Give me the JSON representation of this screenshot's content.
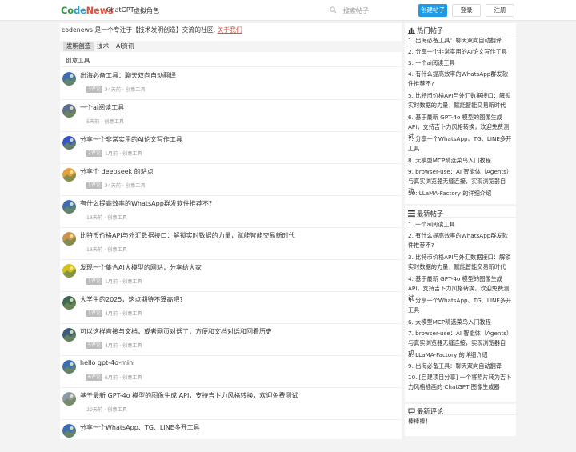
{
  "header": {
    "logo_1": "Co",
    "logo_2": "de",
    "logo_3": "News",
    "nav": [
      "ChatGPT",
      "虚拟角色"
    ],
    "search_placeholder": "搜索帖子",
    "create_button": "创建帖子",
    "login_button": "登录",
    "register_button": "注册"
  },
  "notice": {
    "text": "codenews 是一个专注于【技术发明创造】交流的社区.",
    "link": "关于我们"
  },
  "tabs": [
    "发明创造",
    "技术",
    "AI资讯"
  ],
  "subtab": "创意工具",
  "posts": [
    {
      "title": "出海必备工具：聊天双向自动翻译",
      "badge": "3评论",
      "time": "24天前",
      "category": "创意工具",
      "avatar_color": "#3b6fb2"
    },
    {
      "title": "一个ai阅读工具",
      "badge": "",
      "time": "5天前",
      "category": "创意工具",
      "avatar_color": "#5a6e8e"
    },
    {
      "title": "分享一个非常实用的AI论文写作工具",
      "badge": "2评论",
      "time": "1月前",
      "category": "创意工具",
      "avatar_color": "#3556c9"
    },
    {
      "title": "分享个 deepseek 的站点",
      "badge": "1评论",
      "time": "24天前",
      "category": "创意工具",
      "avatar_color": "#e3a23a"
    },
    {
      "title": "有什么提高效率的WhatsApp群发软件推荐不?",
      "badge": "",
      "time": "13天前",
      "category": "创意工具",
      "avatar_color": "#3b6fb2"
    },
    {
      "title": "比特币价格API与外汇数据接口：解锁实时数据的力量，赋能智能交易新时代",
      "badge": "",
      "time": "13天前",
      "category": "创意工具",
      "avatar_color": "#c9954a"
    },
    {
      "title": "发现一个集合AI大模型的网站，分享给大家",
      "badge": "1评论",
      "time": "1月前",
      "category": "创意工具",
      "avatar_color": "#d4c21a"
    },
    {
      "title": "大学生的2025，这点期待不算高吧?",
      "badge": "1评论",
      "time": "4月前",
      "category": "创意工具",
      "avatar_color": "#3d6a55"
    },
    {
      "title": "可以这样直接与文档，或者网页对话了，方便和文档对话和回看历史",
      "badge": "5评论",
      "time": "4月前",
      "category": "创意工具",
      "avatar_color": "#3b5c7a"
    },
    {
      "title": "hello gpt-4o-mini",
      "badge": "6评论",
      "time": "6月前",
      "category": "创意工具",
      "avatar_color": "#3b6fb2"
    },
    {
      "title": "基于最新 GPT-4o 模型的图像生成 API，支持吉卜力风格转换，欢迎免费测试",
      "badge": "",
      "time": "20天前",
      "category": "创意工具",
      "avatar_color": "#8a9aa8"
    },
    {
      "title": "分享一个WhatsApp、TG、LINE多开工具",
      "badge": "",
      "time": "",
      "category": "",
      "avatar_color": "#3b6fb2"
    }
  ],
  "hot": {
    "title": "热门帖子",
    "icon": "chart-icon",
    "items": [
      "1. 出海必备工具：聊天双向自动翻译",
      "2. 分享一个非常实用的AI论文写作工具",
      "3. 一个ai阅读工具",
      "4. 有什么提高效率的WhatsApp群发软件推荐不?",
      "5. 比特币价格API与外汇数据接口：解锁实时数据的力量，赋能智能交易新时代",
      "6. 基于最新 GPT-4o 模型的图像生成 API，支持吉卜力风格转换，欢迎免费测试",
      "7. 分享一个WhatsApp、TG、LINE多开工具",
      "8. 大模型MCP精选菜鸟入门教程",
      "9. browser-use：AI 智能体（Agents）与真实浏览器无缝连接，实现浏览器自动...",
      "10. LLaMA-Factory 的详细介绍"
    ]
  },
  "latest": {
    "title": "最新帖子",
    "icon": "list-icon",
    "items": [
      "1. 一个ai阅读工具",
      "2. 有什么提高效率的WhatsApp群发软件推荐不?",
      "3. 比特币价格API与外汇数据接口：解锁实时数据的力量，赋能智能交易新时代",
      "4. 基于最新 GPT-4o 模型的图像生成 API，支持吉卜力风格转换，欢迎免费测试",
      "5. 分享一个WhatsApp、TG、LINE多开工具",
      "6. 大模型MCP精选菜鸟入门教程",
      "7. browser-use：AI 智能体（Agents）与真实浏览器无缝连接，实现浏览器自动...",
      "8. LLaMA-Factory 的详细介绍",
      "9. 出海必备工具：聊天双向自动翻译",
      "10. [自建项目分享] 一个将照片转为吉卜力风格插画的 ChatGPT 图像生成器"
    ]
  },
  "comments": {
    "title": "最新评论",
    "icon": "comment-icon",
    "items": [
      "棒棒棒！"
    ]
  },
  "colors": {
    "accent": "#1e9be8",
    "link": "#e0503b",
    "logo_green": "#2a9d3f",
    "logo_blue": "#27a0cf"
  }
}
